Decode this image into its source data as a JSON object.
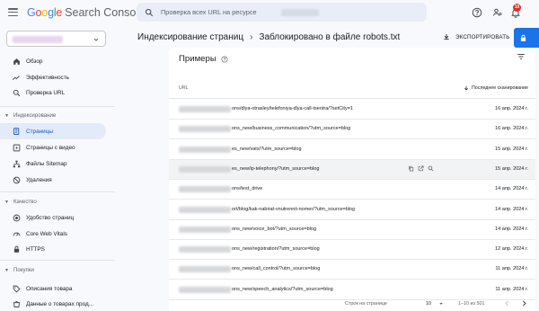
{
  "header": {
    "logo_google": "Google",
    "logo_product": "Search Console",
    "search_placeholder": "Проверка всех URL на ресурсе",
    "notification_count": "10"
  },
  "sidebar": {
    "items": [
      {
        "label": "Обзор",
        "icon": "home-icon"
      },
      {
        "label": "Эффективность",
        "icon": "trend-icon"
      },
      {
        "label": "Проверка URL",
        "icon": "search-icon"
      }
    ],
    "indexing": {
      "heading": "Индексирование",
      "items": [
        {
          "label": "Страницы",
          "icon": "pages-icon",
          "active": true
        },
        {
          "label": "Страницы с видео",
          "icon": "video-icon"
        },
        {
          "label": "Файлы Sitemap",
          "icon": "sitemap-icon"
        },
        {
          "label": "Удаления",
          "icon": "removals-icon"
        }
      ]
    },
    "quality": {
      "heading": "Качество",
      "items": [
        {
          "label": "Удобство страниц",
          "icon": "experience-icon"
        },
        {
          "label": "Core Web Vitals",
          "icon": "speed-icon"
        },
        {
          "label": "HTTPS",
          "icon": "lock-icon"
        }
      ]
    },
    "shopping": {
      "heading": "Покупки",
      "items": [
        {
          "label": "Описания товара",
          "icon": "tag-icon"
        },
        {
          "label": "Данные о товарах прод...",
          "icon": "product-icon"
        }
      ]
    }
  },
  "breadcrumb": {
    "parent": "Индексирование страниц",
    "current": "Заблокировано в файле robots.txt"
  },
  "export_label": "ЭКСПОРТИРОВАТЬ",
  "card": {
    "title": "Примеры",
    "col_url": "URL",
    "col_date": "Последнее сканирование"
  },
  "rows": [
    {
      "url": "ons/dlya-otrasley/telefoniya-dlya-call-tsentra/?setCity=1",
      "date": "16 апр. 2024 г."
    },
    {
      "url": "ons_new/business_communication/?utm_source=blog",
      "date": "16 апр. 2024 г."
    },
    {
      "url": "es_new/vats/?utm_source=blog",
      "date": "15 апр. 2024 г."
    },
    {
      "url": "es_new/ip-telephony/?utm_source=blog",
      "date": "15 апр. 2024 г."
    },
    {
      "url": "ons/test_drive",
      "date": "14 апр. 2024 г."
    },
    {
      "url": "ort/blog/kak-nabirat-vnutrennii-nomer/?utm_source=blog",
      "date": "14 апр. 2024 г."
    },
    {
      "url": "ons_new/voice_bot/?utm_source=blog",
      "date": "14 апр. 2024 г."
    },
    {
      "url": "ons_new/registration/?utm_source=blog",
      "date": "12 апр. 2024 г."
    },
    {
      "url": "ons_new/call_control/?utm_source=blog",
      "date": "11 апр. 2024 г."
    },
    {
      "url": "ons_new/speech_analytics/?utm_source=blog",
      "date": "11 апр. 2024 г."
    }
  ],
  "pager": {
    "rows_label": "Строк на странице",
    "rows_value": "10",
    "range": "1–10 из 501"
  },
  "colors": {
    "accent": "#1a73e8",
    "active_bg": "#e3eaf9",
    "badge": "#d93025"
  }
}
